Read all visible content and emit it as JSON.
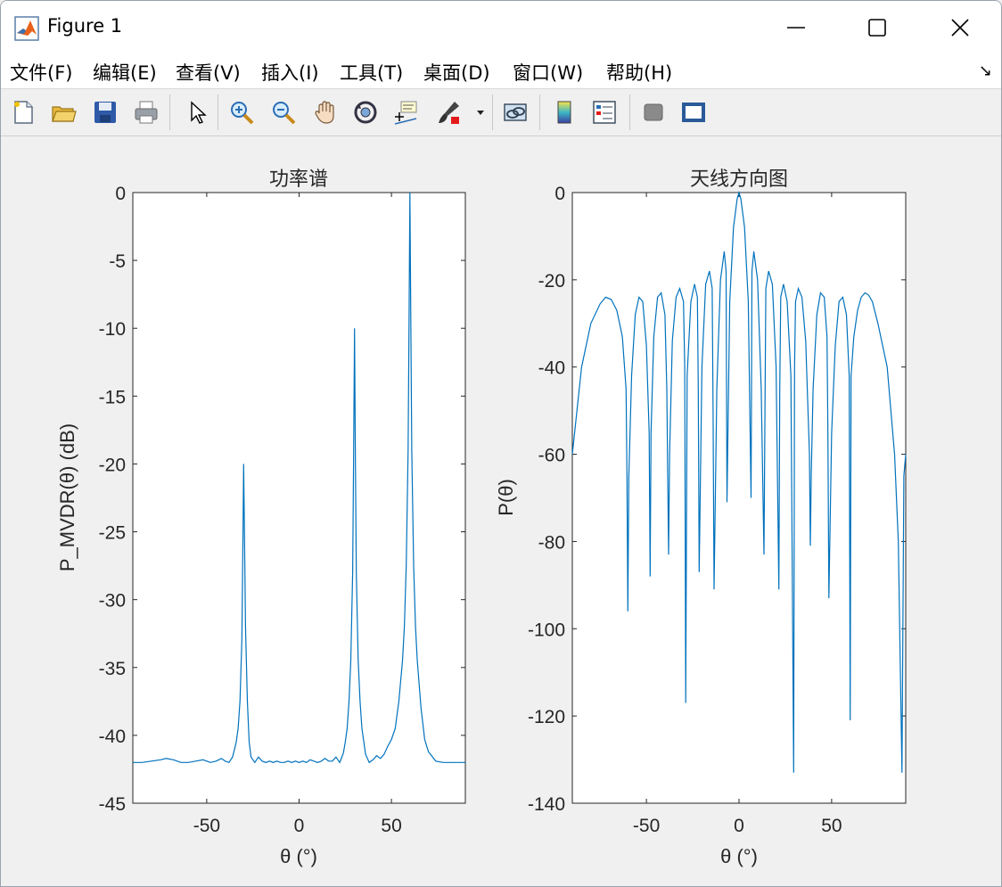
{
  "window": {
    "title": "Figure 1"
  },
  "menu": {
    "items": [
      "文件(F)",
      "编辑(E)",
      "查看(V)",
      "插入(I)",
      "工具(T)",
      "桌面(D)",
      "窗口(W)",
      "帮助(H)"
    ]
  },
  "toolbar": {
    "icons": [
      "new-figure-icon",
      "open-file-icon",
      "save-icon",
      "print-icon",
      "select-arrow-icon",
      "zoom-in-icon",
      "zoom-out-icon",
      "pan-hand-icon",
      "rotate-3d-icon",
      "data-cursor-icon",
      "brush-icon",
      "brush-dropdown-icon",
      "link-plot-icon",
      "colorbar-icon",
      "legend-icon",
      "hide-plot-tools-icon",
      "show-plot-tools-icon"
    ]
  },
  "colors": {
    "line": "#0072bd"
  },
  "chart_data": [
    {
      "type": "line",
      "title": "功率谱",
      "xlabel": "θ (°)",
      "ylabel": "P_MVDR(θ) (dB)",
      "xlim": [
        -90,
        90
      ],
      "ylim": [
        -45,
        0
      ],
      "xticks": [
        -50,
        0,
        50
      ],
      "yticks": [
        0,
        -5,
        -10,
        -15,
        -20,
        -25,
        -30,
        -35,
        -40,
        -45
      ],
      "xtick_labels": [
        "-50",
        "0",
        "50"
      ],
      "ytick_labels": [
        "0",
        "-5",
        "-10",
        "-15",
        "-20",
        "-25",
        "-30",
        "-35",
        "-40",
        "-45"
      ],
      "grid": false,
      "peaks": [
        {
          "x": -30,
          "y": -20
        },
        {
          "x": 30,
          "y": -10
        },
        {
          "x": 60,
          "y": 0
        }
      ],
      "series": [
        {
          "x": [
            -90,
            -85,
            -80,
            -75,
            -72,
            -68,
            -64,
            -60,
            -56,
            -52,
            -48,
            -45,
            -42,
            -40,
            -38,
            -36,
            -34,
            -33,
            -32,
            -31,
            -30.5,
            -30,
            -29.5,
            -29,
            -28,
            -27,
            -26,
            -24,
            -22,
            -20,
            -18,
            -16,
            -14,
            -12,
            -10,
            -8,
            -6,
            -4,
            -2,
            0,
            2,
            4,
            6,
            8,
            10,
            12,
            14,
            16,
            18,
            20,
            22,
            24,
            25,
            26,
            27,
            28,
            29,
            29.5,
            30,
            30.5,
            31,
            32,
            33,
            34,
            36,
            38,
            40,
            42,
            44,
            46,
            48,
            50,
            52,
            54,
            56,
            57,
            58,
            59,
            59.5,
            60,
            60.5,
            61,
            62,
            63,
            64,
            66,
            68,
            70,
            74,
            78,
            82,
            86,
            90
          ],
          "y": [
            -42,
            -42,
            -41.9,
            -41.8,
            -41.7,
            -41.8,
            -42,
            -42,
            -41.9,
            -41.8,
            -42,
            -41.9,
            -41.7,
            -41.9,
            -42,
            -41.6,
            -40.5,
            -39.5,
            -37.5,
            -33,
            -27,
            -20,
            -26,
            -32,
            -37.5,
            -40.5,
            -41.6,
            -42,
            -41.6,
            -41.9,
            -42,
            -41.9,
            -42,
            -41.9,
            -42,
            -42,
            -41.9,
            -42,
            -41.9,
            -42,
            -41.9,
            -42,
            -41.8,
            -41.9,
            -42,
            -41.9,
            -41.7,
            -41.9,
            -41.9,
            -41.6,
            -42,
            -41.3,
            -40.5,
            -39.5,
            -37.5,
            -34.5,
            -28,
            -20,
            -10,
            -20,
            -28,
            -34.5,
            -37.5,
            -39.5,
            -41.4,
            -42,
            -41.8,
            -41.5,
            -41.7,
            -41.4,
            -40.8,
            -40.3,
            -39.5,
            -37.5,
            -34.5,
            -32,
            -27.5,
            -19,
            -10,
            0,
            -10,
            -19,
            -27.5,
            -32,
            -34.5,
            -38,
            -40.3,
            -41.2,
            -41.9,
            -42,
            -42,
            -42,
            -42
          ]
        }
      ]
    },
    {
      "type": "line",
      "title": "天线方向图",
      "xlabel": "θ (°)",
      "ylabel": "P(θ)",
      "xlim": [
        -90,
        90
      ],
      "ylim": [
        -140,
        0
      ],
      "xticks": [
        -50,
        0,
        50
      ],
      "yticks": [
        0,
        -20,
        -40,
        -60,
        -80,
        -100,
        -120,
        -140
      ],
      "xtick_labels": [
        "-50",
        "0",
        "50"
      ],
      "ytick_labels": [
        "0",
        "-20",
        "-40",
        "-60",
        "-80",
        "-100",
        "-120",
        "-140"
      ],
      "grid": false,
      "series": [
        {
          "x": [
            -90,
            -85,
            -80,
            -75,
            -72,
            -69,
            -66,
            -63,
            -61,
            -60.5,
            -60,
            -59.5,
            -58,
            -56,
            -54,
            -52,
            -50,
            -48.5,
            -48,
            -47.5,
            -46,
            -44,
            -42,
            -40,
            -39,
            -38.5,
            -38,
            -37.5,
            -36,
            -34,
            -32,
            -30,
            -29.3,
            -28.8,
            -28,
            -26,
            -24,
            -22.5,
            -22,
            -21.5,
            -20,
            -18,
            -16,
            -14.5,
            -14,
            -13.5,
            -12,
            -10,
            -8,
            -7,
            -6.8,
            -6.5,
            -5,
            -3,
            -1,
            0,
            1,
            3,
            5,
            6.5,
            6.8,
            7,
            8,
            10,
            12,
            13.5,
            14,
            14.5,
            16,
            18,
            20,
            21.5,
            22,
            22.5,
            24,
            26,
            28,
            29.5,
            30,
            30.5,
            32,
            34,
            36,
            38,
            38.5,
            39,
            40,
            42,
            44,
            46,
            47.5,
            48,
            48.5,
            50,
            52,
            54,
            56,
            58,
            59.5,
            60,
            60.5,
            62,
            64,
            66,
            68,
            70,
            72,
            75,
            80,
            84,
            86,
            88,
            89,
            90
          ],
          "y": [
            -60,
            -40,
            -30,
            -25.5,
            -24,
            -24.5,
            -27,
            -33,
            -45,
            -65,
            -96,
            -65,
            -42,
            -28,
            -24,
            -25,
            -35,
            -55,
            -88,
            -55,
            -33,
            -24,
            -23,
            -28,
            -45,
            -65,
            -83,
            -60,
            -34,
            -24,
            -22,
            -25,
            -40,
            -117,
            -42,
            -25,
            -21,
            -24,
            -45,
            -87,
            -40,
            -21,
            -18,
            -22,
            -50,
            -91,
            -45,
            -20,
            -13.5,
            -18,
            -40,
            -71,
            -25,
            -8,
            -1.5,
            0,
            -1.5,
            -8,
            -25,
            -70,
            -40,
            -18,
            -13.5,
            -20,
            -45,
            -83,
            -50,
            -22,
            -18,
            -21,
            -40,
            -91,
            -45,
            -24,
            -21,
            -25,
            -42,
            -133,
            -40,
            -25,
            -22,
            -24,
            -34,
            -60,
            -81,
            -65,
            -45,
            -28,
            -23,
            -24,
            -33,
            -55,
            -93,
            -55,
            -35,
            -25,
            -24,
            -28,
            -42,
            -121,
            -42,
            -33,
            -27,
            -24,
            -23,
            -23.5,
            -25,
            -30,
            -40,
            -60,
            -80,
            -133,
            -65,
            -60
          ]
        }
      ]
    }
  ]
}
